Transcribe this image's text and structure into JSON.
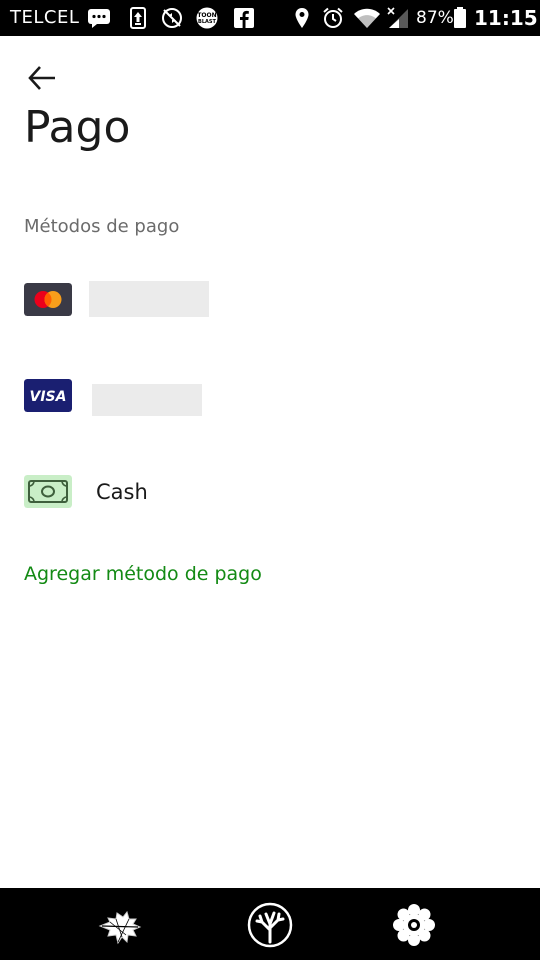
{
  "status_bar": {
    "carrier": "TELCEL",
    "battery": "87%",
    "time": "11:15",
    "icons": [
      "chat-icon",
      "upload-icon",
      "no-sync-icon",
      "toon-blast-icon",
      "facebook-icon",
      "location-icon",
      "alarm-icon",
      "wifi-icon",
      "signal-icon",
      "battery-icon"
    ],
    "toon_blast_text": "TOON BLAST"
  },
  "header": {
    "back_icon": "arrow-left-icon",
    "title": "Pago"
  },
  "payment_methods": {
    "section_label": "Métodos de pago",
    "items": [
      {
        "type": "card",
        "brand": "mastercard",
        "label": ""
      },
      {
        "type": "card",
        "brand": "visa",
        "brand_text": "VISA",
        "label": ""
      },
      {
        "type": "cash",
        "label": "Cash"
      }
    ],
    "add_label": "Agregar método de pago"
  },
  "bottom_nav": {
    "items": [
      "tree-icon",
      "tree-circle-icon",
      "flower-icon"
    ]
  },
  "colors": {
    "accent_green": "#138a14",
    "visa_blue": "#1a1f71",
    "cash_green": "#c9eec7",
    "mastercard_bg": "#3a3a46"
  }
}
